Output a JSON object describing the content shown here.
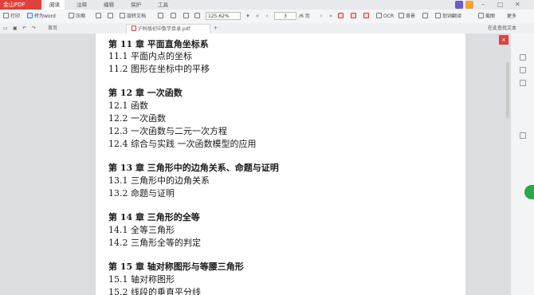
{
  "menubar": {
    "brand": "金山PDF",
    "items": [
      "阅读",
      "注释",
      "编辑",
      "保护",
      "工具"
    ],
    "active_index": 0
  },
  "toolbar": {
    "print": "打印",
    "to_word": "转为word",
    "compress": "压缩",
    "rotate": "旋转文档",
    "zoom": "125.62%",
    "page_current": "3",
    "page_total": "/6 页",
    "ocr": "OCR",
    "background": "背景",
    "translate": "划词翻译",
    "screenshot": "截图",
    "more": "更多"
  },
  "tabs": {
    "home": "首页",
    "document": "沪科版初中数学目录.pdf",
    "add": "+",
    "search_text": "在此查找文本"
  },
  "document": {
    "lines": [
      {
        "text": "第 11 章  平面直角坐标系",
        "type": "heading"
      },
      {
        "text": "11.1 平面内点的坐标",
        "type": "section"
      },
      {
        "text": "11.2 图形在坐标中的平移",
        "type": "section"
      },
      {
        "text": "第 12 章  一次函数",
        "type": "heading"
      },
      {
        "text": "12.1 函数",
        "type": "section"
      },
      {
        "text": "12.2 一次函数",
        "type": "section"
      },
      {
        "text": "12.3 一次函数与二元一次方程",
        "type": "section"
      },
      {
        "text": "12.4 综合与实践  一次函数模型的应用",
        "type": "section"
      },
      {
        "text": "第 13 章  三角形中的边角关系、命题与证明",
        "type": "heading"
      },
      {
        "text": "13.1 三角形中的边角关系",
        "type": "section"
      },
      {
        "text": "13.2 命题与证明",
        "type": "section"
      },
      {
        "text": "第 14 章  三角形的全等",
        "type": "heading"
      },
      {
        "text": "14.1 全等三角形",
        "type": "section"
      },
      {
        "text": "14.2 三角形全等的判定",
        "type": "section"
      },
      {
        "text": "第 15 章  轴对称图形与等腰三角形",
        "type": "heading"
      },
      {
        "text": "15.1 轴对称图形",
        "type": "section"
      },
      {
        "text": "15.2 线段的垂直平分线",
        "type": "section"
      }
    ]
  },
  "colors": {
    "brand": "#e0413a",
    "float_button": "#2aa84a"
  }
}
